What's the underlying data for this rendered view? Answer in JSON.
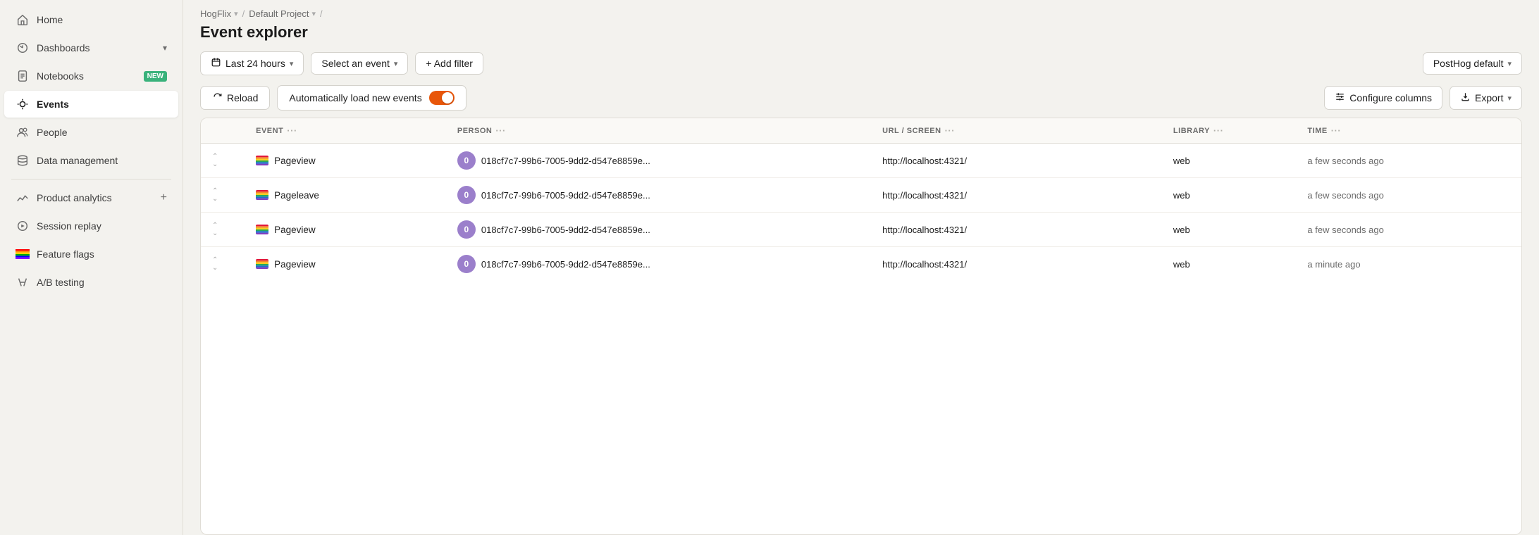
{
  "sidebar": {
    "items": [
      {
        "id": "home",
        "label": "Home",
        "icon": "home",
        "active": false
      },
      {
        "id": "dashboards",
        "label": "Dashboards",
        "icon": "dashboards",
        "active": false,
        "chevron": true
      },
      {
        "id": "notebooks",
        "label": "Notebooks",
        "icon": "notebooks",
        "active": false,
        "badge": "NEW"
      },
      {
        "id": "events",
        "label": "Events",
        "icon": "events",
        "active": true
      },
      {
        "id": "people",
        "label": "People",
        "icon": "people",
        "active": false
      },
      {
        "id": "data-management",
        "label": "Data management",
        "icon": "data",
        "active": false
      },
      {
        "id": "product-analytics",
        "label": "Product analytics",
        "icon": "analytics",
        "active": false,
        "plus": true
      },
      {
        "id": "session-replay",
        "label": "Session replay",
        "icon": "replay",
        "active": false
      },
      {
        "id": "feature-flags",
        "label": "Feature flags",
        "icon": "flags",
        "active": false
      },
      {
        "id": "ab-testing",
        "label": "A/B testing",
        "icon": "ab",
        "active": false
      }
    ]
  },
  "breadcrumb": {
    "items": [
      {
        "label": "HogFlix",
        "chevron": true
      },
      {
        "label": "Default Project",
        "chevron": true
      },
      {
        "label": ""
      }
    ]
  },
  "page": {
    "title": "Event explorer"
  },
  "toolbar": {
    "time_filter_label": "Last 24 hours",
    "event_select_label": "Select an event",
    "add_filter_label": "+ Add filter",
    "dataset_label": "PostHog default"
  },
  "action_bar": {
    "reload_label": "Reload",
    "auto_load_label": "Automatically load new events",
    "configure_columns_label": "Configure columns",
    "export_label": "Export"
  },
  "table": {
    "columns": [
      {
        "id": "expand",
        "label": ""
      },
      {
        "id": "event",
        "label": "EVENT"
      },
      {
        "id": "person",
        "label": "PERSON"
      },
      {
        "id": "url",
        "label": "URL / SCREEN"
      },
      {
        "id": "library",
        "label": "LIBRARY"
      },
      {
        "id": "time",
        "label": "TIME"
      }
    ],
    "rows": [
      {
        "event": "Pageview",
        "person_id": "0",
        "person_value": "018cf7c7-99b6-7005-9dd2-d547e8859e...",
        "url": "http://localhost:4321/",
        "library": "web",
        "time": "a few seconds ago"
      },
      {
        "event": "Pageleave",
        "person_id": "0",
        "person_value": "018cf7c7-99b6-7005-9dd2-d547e8859e...",
        "url": "http://localhost:4321/",
        "library": "web",
        "time": "a few seconds ago"
      },
      {
        "event": "Pageview",
        "person_id": "0",
        "person_value": "018cf7c7-99b6-7005-9dd2-d547e8859e...",
        "url": "http://localhost:4321/",
        "library": "web",
        "time": "a few seconds ago"
      },
      {
        "event": "Pageview",
        "person_id": "0",
        "person_value": "018cf7c7-99b6-7005-9dd2-d547e8859e...",
        "url": "http://localhost:4321/",
        "library": "web",
        "time": "a minute ago"
      }
    ]
  },
  "colors": {
    "accent": "#e8560a",
    "active_bg": "#ffffff",
    "sidebar_bg": "#f3f2ee",
    "badge_green": "#39b27b"
  }
}
